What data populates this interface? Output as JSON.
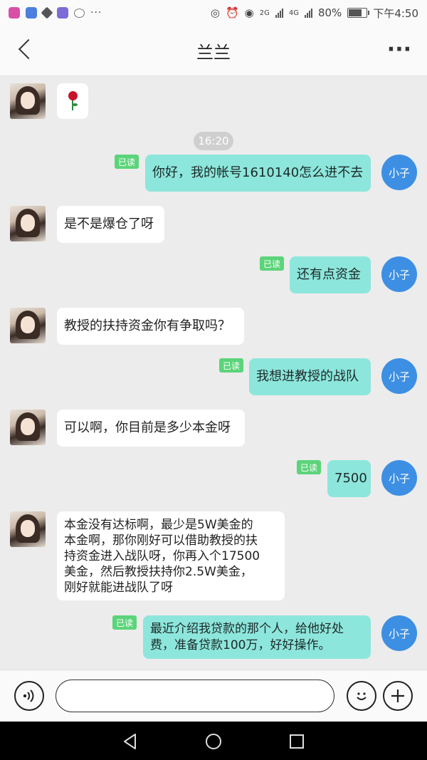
{
  "status_bar": {
    "battery": "80%",
    "time": "下午4:50",
    "network_a": "2G",
    "network_b": "4G"
  },
  "header": {
    "title": "兰兰"
  },
  "chat": {
    "timestamp": "16:20",
    "read_label": "已读",
    "my_name": "小子",
    "messages": [
      {
        "side": "left",
        "type": "rose"
      },
      {
        "side": "right",
        "text": "你好，我的帐号1610140怎么进不去"
      },
      {
        "side": "left",
        "text": "是不是爆仓了呀"
      },
      {
        "side": "right",
        "text": "还有点资金"
      },
      {
        "side": "left",
        "text": "教授的扶持资金你有争取吗？"
      },
      {
        "side": "right",
        "text": "我想进教授的战队"
      },
      {
        "side": "left",
        "text": "可以啊，你目前是多少本金呀"
      },
      {
        "side": "right",
        "text": "7500"
      },
      {
        "side": "left",
        "lines": [
          "本金没有达标啊，最少是5W美金的",
          "本金啊，那你刚好可以借助教授的扶",
          "持资金进入战队呀，你再入个17500",
          "美金，然后教授扶持你2.5W美金，",
          "刚好就能进战队了呀"
        ]
      },
      {
        "side": "right",
        "lines": [
          "最近介绍我贷款的那个人，给他好处",
          "费，准备贷款100万，好好操作。"
        ]
      }
    ]
  },
  "input": {
    "placeholder": ""
  }
}
